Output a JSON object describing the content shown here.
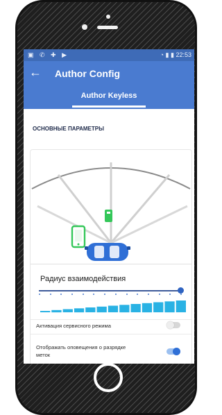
{
  "status_bar": {
    "icons_left": "▣ ✆ ✚ ▶",
    "icons_right": "◔ ▮ ▮",
    "time": "22:53"
  },
  "app_bar": {
    "back_icon": "←",
    "title": "Author Config"
  },
  "tabs": {
    "active": "Author Keyless"
  },
  "section": {
    "title": "ОСНОВНЫЕ ПАРАМЕТРЫ"
  },
  "radius": {
    "label": "Радиус взаимодействия",
    "level_fraction": 1.0
  },
  "options": [
    {
      "label": "Активация сервисного режима",
      "enabled": false
    },
    {
      "label": "Отображать оповещения о разрядке меток",
      "enabled": true
    }
  ],
  "colors": {
    "primary": "#4a7bd0",
    "status_bar": "#3e6bb7",
    "accent": "#2f6fd6",
    "level_bars": "#29b2e4",
    "key_fob": "#34c759"
  },
  "icons": {
    "back": "arrow-left-icon",
    "car": "car-icon",
    "phone": "smartphone-icon",
    "fob": "key-fob-icon"
  }
}
